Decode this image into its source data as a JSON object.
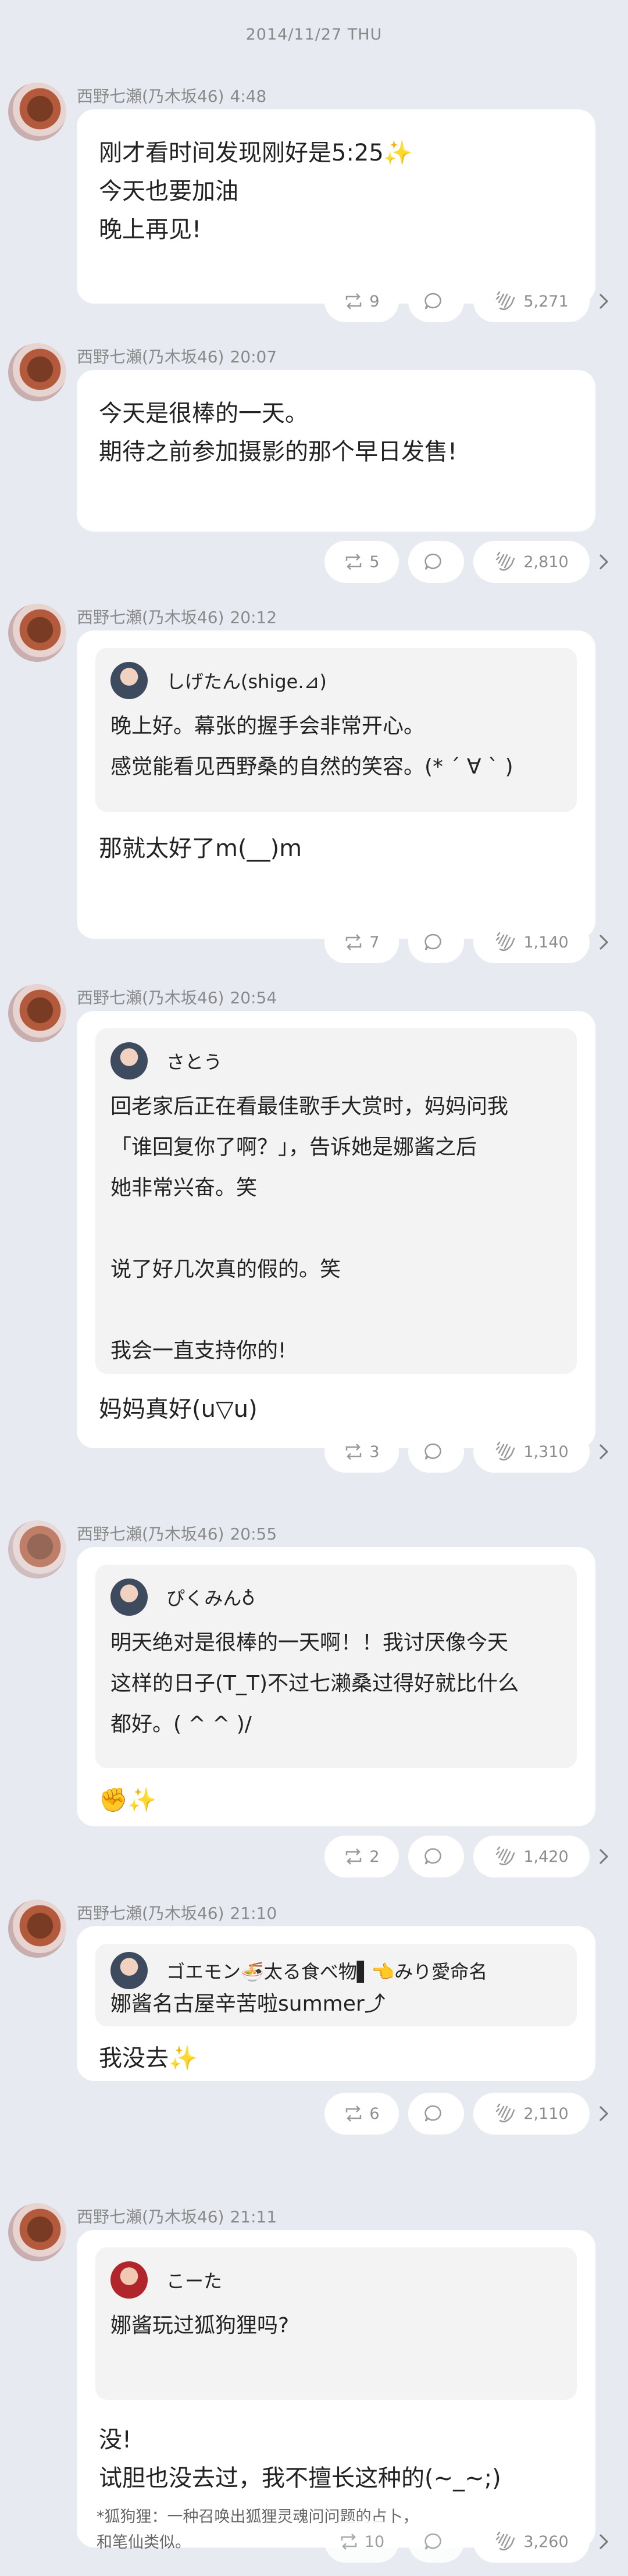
{
  "date_header": "2014/11/27 THU",
  "posts": [
    {
      "author": "西野七瀬(乃木坂46)",
      "time": "4:48",
      "lines": [
        "刚才看时间发现刚好是5:25✨",
        "今天也要加油",
        "晚上再见!"
      ],
      "retweets": "9",
      "claps": "5,271"
    },
    {
      "author": "西野七瀬(乃木坂46)",
      "time": "20:07",
      "lines": [
        "今天是很棒的一天。",
        "期待之前参加摄影的那个早日发售!"
      ],
      "retweets": "5",
      "claps": "2,810"
    },
    {
      "author": "西野七瀬(乃木坂46)",
      "time": "20:12",
      "quote": {
        "name": "しげたん(shige.⊿)",
        "text": "晚上好。幕张的握手会非常开心。\n感觉能看见西野桑的自然的笑容。(* ´ ∀ ` )"
      },
      "lines": [
        "那就太好了m(__)m"
      ],
      "retweets": "7",
      "claps": "1,140"
    },
    {
      "author": "西野七瀬(乃木坂46)",
      "time": "20:54",
      "quote": {
        "name": "さとう",
        "text": "回老家后正在看最佳歌手大赏时，妈妈问我\n「谁回复你了啊？」，告诉她是娜酱之后\n她非常兴奋。笑\n\n说了好几次真的假的。笑\n\n我会一直支持你的!"
      },
      "lines": [
        "妈妈真好(u▽u)"
      ],
      "retweets": "3",
      "claps": "1,310"
    },
    {
      "author": "西野七瀬(乃木坂46)",
      "time": "20:55",
      "quote": {
        "name": "ぴくみん♁",
        "text": "明天绝对是很棒的一天啊！！我讨厌像今天\n这样的日子(T_T)不过七濑桑过得好就比什么\n都好。( ^ ^ )/"
      },
      "lines": [
        "✊✨"
      ],
      "retweets": "2",
      "claps": "1,420"
    },
    {
      "author": "西野七瀬(乃木坂46)",
      "time": "21:10",
      "quote": {
        "name": "ゴエモン🍜太る食べ物▌👈みり愛命名",
        "text": "娜酱名古屋辛苦啦summer⤴"
      },
      "lines": [
        "我没去✨"
      ],
      "retweets": "6",
      "claps": "2,110"
    },
    {
      "author": "西野七瀬(乃木坂46)",
      "time": "21:11",
      "quote": {
        "name": "こーた",
        "text": "娜酱玩过狐狗狸吗?"
      },
      "lines": [
        "没!",
        "试胆也没去过，我不擅长这种的(~_~;)"
      ],
      "note": "*狐狗狸：一种召唤出狐狸灵魂问问题的占卜，\n和笔仙类似。",
      "retweets": "10",
      "claps": "3,260"
    }
  ]
}
